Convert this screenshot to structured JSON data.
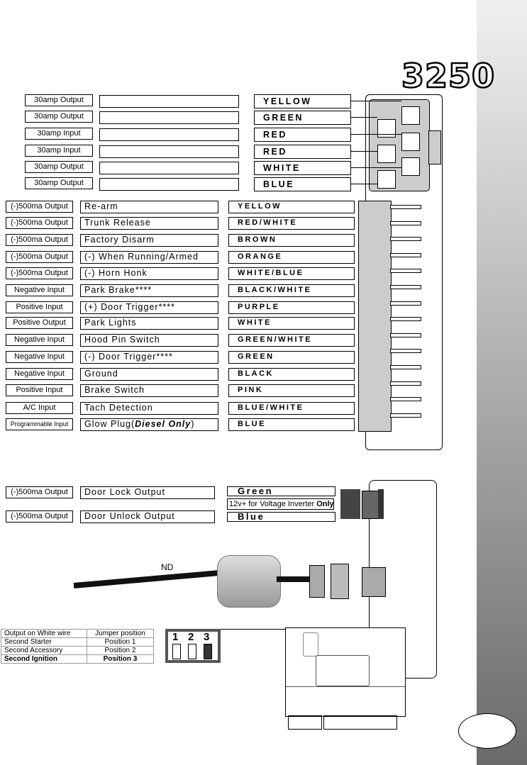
{
  "model": "3250",
  "high_current": [
    {
      "type": "30amp Output",
      "function": "",
      "color": "YELLOW"
    },
    {
      "type": "30amp Output",
      "function": "",
      "color": "GREEN"
    },
    {
      "type": "30amp Input",
      "function": "",
      "color": "RED"
    },
    {
      "type": "30amp Input",
      "function": "",
      "color": "RED"
    },
    {
      "type": "30amp Output",
      "function": "",
      "color": "WHITE"
    },
    {
      "type": "30amp Output",
      "function": "",
      "color": "BLUE"
    }
  ],
  "main_harness": [
    {
      "type": "(-)500ma Output",
      "function": "Re-arm",
      "color": "YELLOW"
    },
    {
      "type": "(-)500ma Output",
      "function": "Trunk Release",
      "color": "RED/WHITE"
    },
    {
      "type": "(-)500ma Output",
      "function": "Factory Disarm",
      "color": "BROWN"
    },
    {
      "type": "(-)500ma Output",
      "function": "(-) When Running/Armed",
      "color": "ORANGE"
    },
    {
      "type": "(-)500ma Output",
      "function": "(-) Horn Honk",
      "color": "WHITE/BLUE"
    },
    {
      "type": "Negative Input",
      "function": "Park Brake****",
      "color": "BLACK/WHITE"
    },
    {
      "type": "Positive Input",
      "function": "(+) Door Trigger****",
      "color": "PURPLE"
    },
    {
      "type": "Positive Output",
      "function": "Park Lights",
      "color": "WHITE"
    },
    {
      "type": "Negative Input",
      "function": "Hood Pin Switch",
      "color": "GREEN/WHITE"
    },
    {
      "type": "Negative Input",
      "function": "(-) Door Trigger****",
      "color": "GREEN"
    },
    {
      "type": "Negative Input",
      "function": "Ground",
      "color": "BLACK"
    },
    {
      "type": "Positive Input",
      "function": "Brake Switch",
      "color": "PINK"
    },
    {
      "type": "A/C Input",
      "function": "Tach Detection",
      "color": "BLUE/WHITE"
    },
    {
      "type": "Programmable Input",
      "function": "Glow Plug(",
      "function_em": "Diesel Only",
      "function_end": ")",
      "color": "BLUE"
    }
  ],
  "door_lock": [
    {
      "type": "(-)500ma Output",
      "function": "Door Lock Output",
      "color": "Green"
    },
    {
      "type": "(-)500ma Output",
      "function": "Door Unlock Output",
      "color": "Blue"
    }
  ],
  "inverter_note": "12v+ for Voltage Inverter ",
  "inverter_note_bold": "Only",
  "antenna_label": "ND",
  "jumper_table": {
    "headers": [
      "Output on White wire",
      "Jumper position"
    ],
    "rows": [
      [
        "Second Starter",
        "Position 1"
      ],
      [
        "Second Accessory",
        "Position 2"
      ],
      [
        "Second Ignition",
        "Position 3"
      ]
    ]
  },
  "jumper_numbers": [
    "1",
    "2",
    "3"
  ],
  "jumper_selected": 3
}
